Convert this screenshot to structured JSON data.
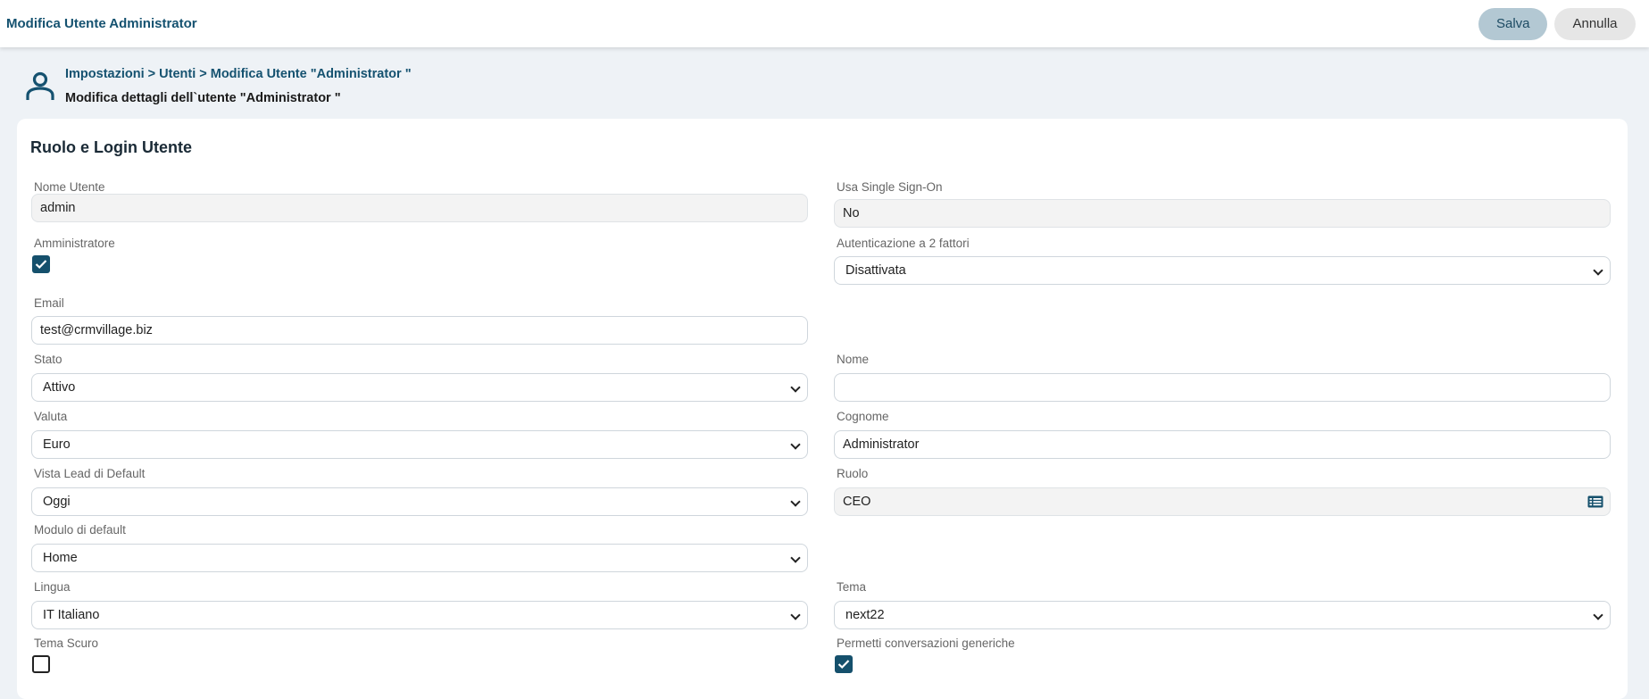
{
  "topbar": {
    "title": "Modifica Utente Administrator",
    "save_label": "Salva",
    "cancel_label": "Annulla"
  },
  "header": {
    "breadcrumb": "Impostazioni > Utenti > Modifica Utente \"Administrator \"",
    "subtitle": "Modifica dettagli dell`utente \"Administrator \""
  },
  "section": {
    "title": "Ruolo e Login Utente"
  },
  "fields": {
    "username": {
      "label": "Nome Utente",
      "value": "admin"
    },
    "sso": {
      "label": "Usa Single Sign-On",
      "value": "No"
    },
    "admin": {
      "label": "Amministratore",
      "checked": true
    },
    "twofa": {
      "label": "Autenticazione a 2 fattori",
      "value": "Disattivata"
    },
    "email": {
      "label": "Email",
      "value": "test@crmvillage.biz"
    },
    "status": {
      "label": "Stato",
      "value": "Attivo"
    },
    "firstname": {
      "label": "Nome",
      "value": ""
    },
    "currency": {
      "label": "Valuta",
      "value": "Euro"
    },
    "lastname": {
      "label": "Cognome",
      "value": "Administrator"
    },
    "leadview": {
      "label": "Vista Lead di Default",
      "value": "Oggi"
    },
    "role": {
      "label": "Ruolo",
      "value": "CEO"
    },
    "defaultmodule": {
      "label": "Modulo di default",
      "value": "Home"
    },
    "language": {
      "label": "Lingua",
      "value": "IT Italiano"
    },
    "theme": {
      "label": "Tema",
      "value": "next22"
    },
    "darktheme": {
      "label": "Tema Scuro",
      "checked": false
    },
    "genericchat": {
      "label": "Permetti conversazioni generiche",
      "checked": true
    }
  },
  "icons": {
    "user": "user-icon",
    "check": "check-icon",
    "chevron": "chevron-down-icon",
    "list": "list-icon"
  },
  "colors": {
    "primary": "#155270",
    "save_bg": "#b3c8d3",
    "cancel_bg": "#e6e6e6",
    "page_bg": "#eef2f6"
  }
}
